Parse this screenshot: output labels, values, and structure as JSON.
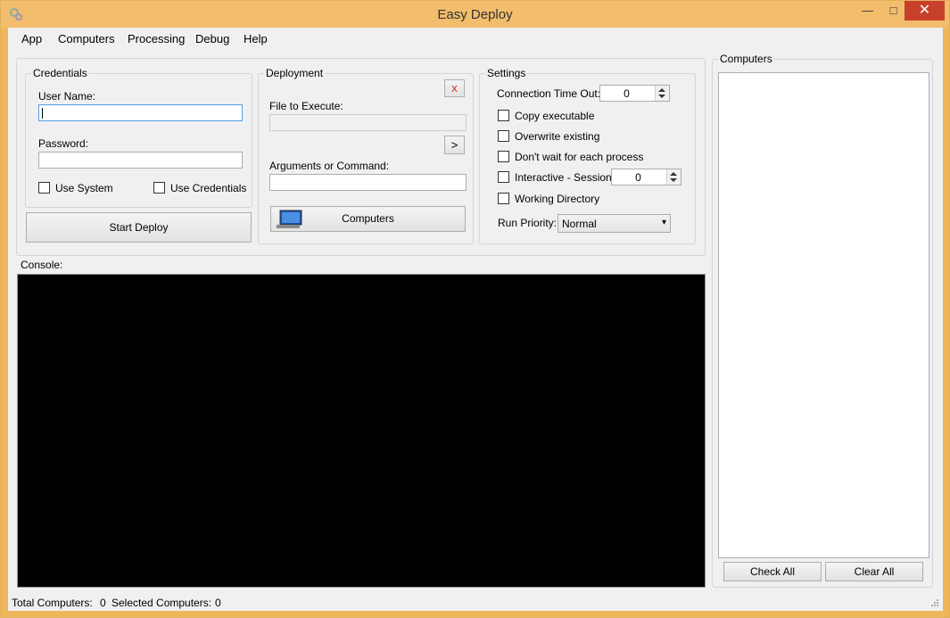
{
  "window": {
    "title": "Easy Deploy",
    "minimize": "—",
    "maximize": "□",
    "close": "✕",
    "icon": "gear-icon"
  },
  "menu": [
    "App",
    "Computers",
    "Processing",
    "Debug",
    "Help"
  ],
  "credentials": {
    "title": "Credentials",
    "username_label": "User Name:",
    "username_value": "",
    "password_label": "Password:",
    "password_value": "",
    "use_system": "Use System",
    "use_credentials": "Use Credentials"
  },
  "start_deploy": "Start Deploy",
  "deployment": {
    "title": "Deployment",
    "clear": "x",
    "file_label": "File to Execute:",
    "file_value": "",
    "browse": ">",
    "args_label": "Arguments or Command:",
    "args_value": "",
    "computers_button": "Computers"
  },
  "settings": {
    "title": "Settings",
    "timeout_label": "Connection Time Out:",
    "timeout_value": "0",
    "copy_exec": "Copy executable",
    "overwrite": "Overwrite existing",
    "dont_wait": "Don't wait for each process",
    "interactive": "Interactive - Session:",
    "session_value": "0",
    "working_dir": "Working Directory",
    "priority_label": "Run Priority:",
    "priority_value": "Normal"
  },
  "console_label": "Console:",
  "computers_panel": {
    "title": "Computers",
    "check_all": "Check All",
    "clear_all": "Clear All"
  },
  "status": {
    "total_label": "Total Computers:",
    "total_value": "0",
    "selected_label": "Selected Computers:",
    "selected_value": "0"
  },
  "colors": {
    "title_bar": "#f2bd6c",
    "close_button": "#c7402b",
    "console_bg": "#000000",
    "client_bg": "#f0f0f0"
  }
}
